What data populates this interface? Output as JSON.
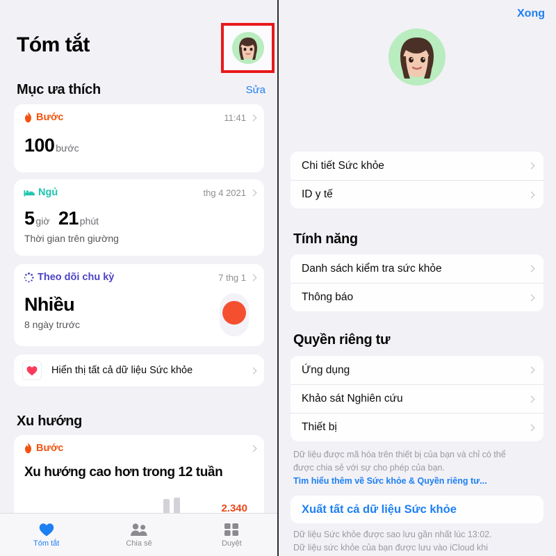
{
  "left": {
    "title": "Tóm tắt",
    "avatar_name": "memoji-avatar",
    "favorites": {
      "heading": "Mục ưa thích",
      "edit_label": "Sửa",
      "cards": [
        {
          "metric": "Bước",
          "icon": "flame-icon",
          "time": "11:41",
          "value": "100",
          "unit": "bước",
          "note": ""
        },
        {
          "metric": "Ngủ",
          "icon": "bed-icon",
          "time": "thg 4 2021",
          "value": "5",
          "unit": "giờ",
          "value2": "21",
          "unit2": "phút",
          "note": "Thời gian trên giường"
        },
        {
          "metric": "Theo dõi chu kỳ",
          "icon": "cycle-dots-icon",
          "time": "7 thg 1",
          "value": "Nhiều",
          "note": "8 ngày trước"
        }
      ],
      "show_all_label": "Hiển thị tất cả dữ liệu Sức khỏe",
      "show_all_icon": "heart-icon"
    },
    "trends": {
      "heading": "Xu hướng",
      "metric": "Bước",
      "icon": "flame-icon",
      "summary": "Xu hướng cao hơn trong 12 tuần",
      "chart_value": "2.340"
    },
    "tabs": [
      {
        "label": "Tóm tắt",
        "icon": "heart-icon",
        "active": true
      },
      {
        "label": "Chia sẻ",
        "icon": "people-icon",
        "active": false
      },
      {
        "label": "Duyệt",
        "icon": "grid-icon",
        "active": false
      }
    ]
  },
  "right": {
    "done_label": "Xong",
    "avatar_name": "memoji-avatar-large",
    "profile_rows": [
      {
        "label": "Chi tiết Sức khỏe"
      },
      {
        "label": "ID y tế",
        "highlighted": true
      }
    ],
    "features": {
      "heading": "Tính năng",
      "rows": [
        {
          "label": "Danh sách kiểm tra sức khỏe"
        },
        {
          "label": "Thông báo"
        }
      ]
    },
    "privacy": {
      "heading": "Quyền riêng tư",
      "rows": [
        {
          "label": "Ứng dụng"
        },
        {
          "label": "Khảo sát Nghiên cứu"
        },
        {
          "label": "Thiết bị"
        }
      ],
      "note_line1": "Dữ liệu được mã hóa trên thiết bị của bạn và chỉ có thể",
      "note_line2": "được chia sẻ với sự cho phép của bạn.",
      "note_link": "Tìm hiểu thêm về Sức khỏe & Quyền riêng tư..."
    },
    "export": {
      "label": "Xuất tất cả dữ liệu Sức khỏe",
      "note_line1": "Dữ liệu Sức khỏe được sao lưu gần nhất lúc 13:02.",
      "note_line2": "Dữ liệu sức khỏe của bạn được lưu vào iCloud khi"
    }
  },
  "colors": {
    "accent_blue": "#1d7ff2",
    "highlight_red": "#e8191b",
    "steps_orange": "#f2530f",
    "sleep_teal": "#1fc4b0",
    "cycle_purple": "#4b43c4",
    "bg_gray": "#f2f1f6"
  }
}
